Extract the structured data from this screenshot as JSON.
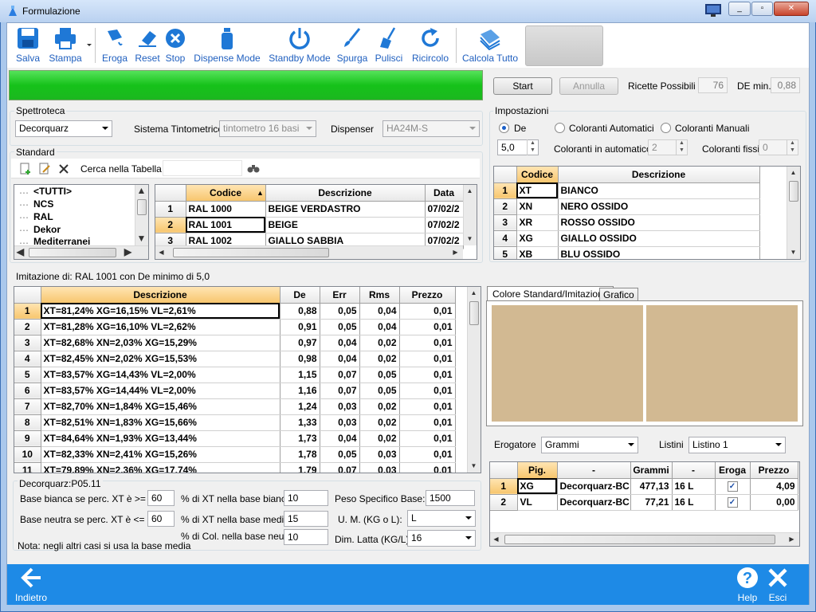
{
  "window": {
    "title": "Formulazione",
    "min": "_",
    "max": "▫",
    "close": "✕"
  },
  "toolbar": {
    "items": [
      {
        "label": "Salva",
        "icon": "save-icon"
      },
      {
        "label": "Stampa",
        "icon": "print-icon"
      },
      {
        "label": "Eroga",
        "icon": "dispense-icon"
      },
      {
        "label": "Reset",
        "icon": "eraser-icon"
      },
      {
        "label": "Stop",
        "icon": "stop-icon"
      },
      {
        "label": "Dispense Mode",
        "icon": "bottle-icon"
      },
      {
        "label": "Standby Mode",
        "icon": "power-icon"
      },
      {
        "label": "Spurga",
        "icon": "brush-icon"
      },
      {
        "label": "Pulisci",
        "icon": "broom-icon"
      },
      {
        "label": "Ricircolo",
        "icon": "refresh-icon"
      },
      {
        "label": "Calcola Tutto",
        "icon": "calculator-books-icon"
      }
    ]
  },
  "progress": {
    "value": 1.0,
    "color": "#17c11c"
  },
  "run": {
    "start": "Start",
    "annulla": "Annulla",
    "ricette_label": "Ricette Possibili",
    "ricette_value": "76",
    "demin_label": "DE min.",
    "demin_value": "0,88"
  },
  "spettroteca": {
    "title": "Spettroteca",
    "value": "Decorquarz",
    "sistema_label": "Sistema Tintometrico",
    "sistema_value": "tintometro 16 basi",
    "dispenser_label": "Dispenser",
    "dispenser_value": "HA24M-S"
  },
  "standard": {
    "title": "Standard",
    "search_label": "Cerca nella Tabella",
    "search_value": "",
    "tree": [
      "<TUTTI>",
      "NCS",
      "RAL",
      "Dekor",
      "Mediterranei"
    ],
    "columns": [
      "Codice",
      "Descrizione",
      "Data"
    ],
    "rows": [
      {
        "n": "1",
        "codice": "RAL 1000",
        "descrizione": "BEIGE VERDASTRO",
        "data": "07/02/2"
      },
      {
        "n": "2",
        "codice": "RAL 1001",
        "descrizione": "BEIGE",
        "data": "07/02/2"
      },
      {
        "n": "3",
        "codice": "RAL 1002",
        "descrizione": "GIALLO SABBIA",
        "data": "07/02/2"
      }
    ]
  },
  "impostazioni": {
    "title": "Impostazioni",
    "opt_de": "De",
    "opt_auto": "Coloranti Automatici",
    "opt_man": "Coloranti Manuali",
    "de_value": "5,0",
    "auto_label": "Coloranti in automatico",
    "auto_value": "2",
    "fissi_label": "Coloranti fissi",
    "fissi_value": "0",
    "columns": [
      "Codice",
      "Descrizione"
    ],
    "rows": [
      {
        "n": "1",
        "codice": "XT",
        "descrizione": "BIANCO"
      },
      {
        "n": "2",
        "codice": "XN",
        "descrizione": "NERO OSSIDO"
      },
      {
        "n": "3",
        "codice": "XR",
        "descrizione": "ROSSO OSSIDO"
      },
      {
        "n": "4",
        "codice": "XG",
        "descrizione": "GIALLO OSSIDO"
      },
      {
        "n": "5",
        "codice": "XB",
        "descrizione": "BLU OSSIDO"
      }
    ]
  },
  "imitazione": {
    "title": "Imitazione di: RAL 1001 con De minimo di 5,0",
    "columns": [
      "Descrizione",
      "De",
      "Err",
      "Rms",
      "Prezzo"
    ],
    "rows": [
      {
        "n": "1",
        "d": "XT=81,24% XG=16,15% VL=2,61%",
        "de": "0,88",
        "err": "0,05",
        "rms": "0,04",
        "prezzo": "0,01"
      },
      {
        "n": "2",
        "d": "XT=81,28% XG=16,10% VL=2,62%",
        "de": "0,91",
        "err": "0,05",
        "rms": "0,04",
        "prezzo": "0,01"
      },
      {
        "n": "3",
        "d": "XT=82,68% XN=2,03% XG=15,29%",
        "de": "0,97",
        "err": "0,04",
        "rms": "0,02",
        "prezzo": "0,01"
      },
      {
        "n": "4",
        "d": "XT=82,45% XN=2,02% XG=15,53%",
        "de": "0,98",
        "err": "0,04",
        "rms": "0,02",
        "prezzo": "0,01"
      },
      {
        "n": "5",
        "d": "XT=83,57% XG=14,43% VL=2,00%",
        "de": "1,15",
        "err": "0,07",
        "rms": "0,05",
        "prezzo": "0,01"
      },
      {
        "n": "6",
        "d": "XT=83,57% XG=14,44% VL=2,00%",
        "de": "1,16",
        "err": "0,07",
        "rms": "0,05",
        "prezzo": "0,01"
      },
      {
        "n": "7",
        "d": "XT=82,70% XN=1,84% XG=15,46%",
        "de": "1,24",
        "err": "0,03",
        "rms": "0,02",
        "prezzo": "0,01"
      },
      {
        "n": "8",
        "d": "XT=82,51% XN=1,83% XG=15,66%",
        "de": "1,33",
        "err": "0,03",
        "rms": "0,02",
        "prezzo": "0,01"
      },
      {
        "n": "9",
        "d": "XT=84,64% XN=1,93% XG=13,44%",
        "de": "1,73",
        "err": "0,04",
        "rms": "0,02",
        "prezzo": "0,01"
      },
      {
        "n": "10",
        "d": "XT=82,33% XN=2,41% XG=15,26%",
        "de": "1,78",
        "err": "0,05",
        "rms": "0,03",
        "prezzo": "0,01"
      },
      {
        "n": "11",
        "d": "XT=79,89% XN=2,36% XG=17,74%",
        "de": "1,79",
        "err": "0,07",
        "rms": "0,03",
        "prezzo": "0,01"
      }
    ]
  },
  "base": {
    "title": "Decorquarz:P05.11",
    "bianca_label": "Base bianca se perc. XT è >= di:",
    "bianca_value": "60",
    "neutra_label": "Base neutra se perc. XT è <= di:",
    "neutra_value": "60",
    "xt_bianca_label": "% di XT nella  base bianca:",
    "xt_bianca_value": "10",
    "xt_media_label": "% di XT nella  base media:",
    "xt_media_value": "15",
    "col_neutra_label": "% di Col. nella  base neutra:",
    "col_neutra_value": "10",
    "peso_label": "Peso Specifico Base:",
    "peso_value": "1500",
    "um_label": "U. M. (KG o L):",
    "um_value": "L",
    "latta_label": "Dim. Latta (KG/L):",
    "latta_value": "16",
    "nota": "Nota: negli altri casi si usa la base media"
  },
  "colore": {
    "tab_active": "Colore Standard/Imitazione",
    "tab_other": "Grafico",
    "standard_color": "#d2b992",
    "imitazione_color": "#d2b992"
  },
  "erogatore": {
    "label": "Erogatore",
    "value": "Grammi",
    "listini_label": "Listini",
    "listini_value": "Listino 1",
    "columns": [
      "Pig.",
      "-",
      "Grammi",
      "-",
      "Eroga",
      "Prezzo"
    ],
    "rows": [
      {
        "n": "1",
        "pig": "XG",
        "base": "Decorquarz-BC",
        "grammi": "477,13",
        "unit": "16 L",
        "eroga": "✓",
        "prezzo": "4,09"
      },
      {
        "n": "2",
        "pig": "VL",
        "base": "Decorquarz-BC",
        "grammi": "77,21",
        "unit": "16 L",
        "eroga": "✓",
        "prezzo": "0,00"
      }
    ]
  },
  "bottom": {
    "back": "Indietro",
    "help": "Help",
    "exit": "Esci"
  }
}
